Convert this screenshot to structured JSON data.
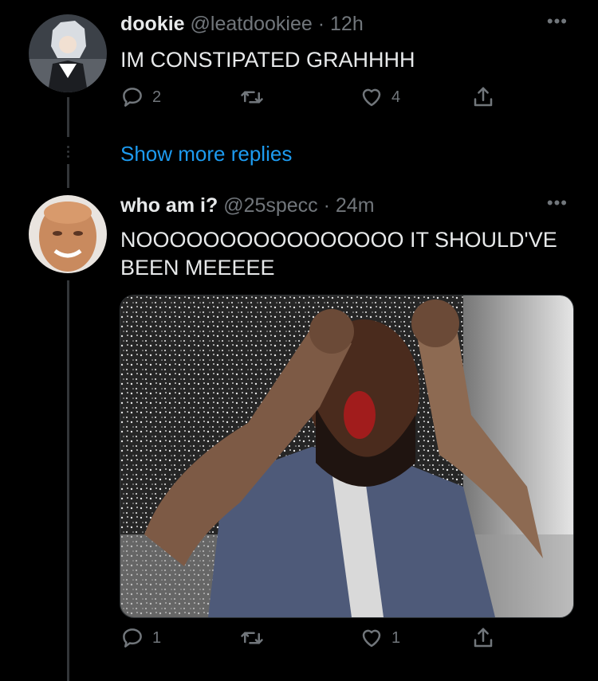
{
  "tweets": [
    {
      "name": "dookie",
      "handle": "@leatdookiee",
      "time": "12h",
      "text": "IM CONSTIPATED GRAHHHH",
      "replies": "2",
      "retweets": "",
      "likes": "4"
    },
    {
      "name": "who am i?",
      "handle": "@25specc",
      "time": "24m",
      "text": "NOOOOOOOOOOOOOOOO IT SHOULD'VE BEEN MEEEEE",
      "replies": "1",
      "retweets": "",
      "likes": "1"
    }
  ],
  "show_more_replies": "Show more replies",
  "icons": {
    "more": "more-horizontal-icon",
    "reply": "reply-icon",
    "retweet": "retweet-icon",
    "like": "like-icon",
    "share": "share-icon"
  },
  "colors": {
    "link": "#1d9bf0",
    "muted": "#71767b",
    "text": "#e7e9ea",
    "background": "#000000"
  }
}
